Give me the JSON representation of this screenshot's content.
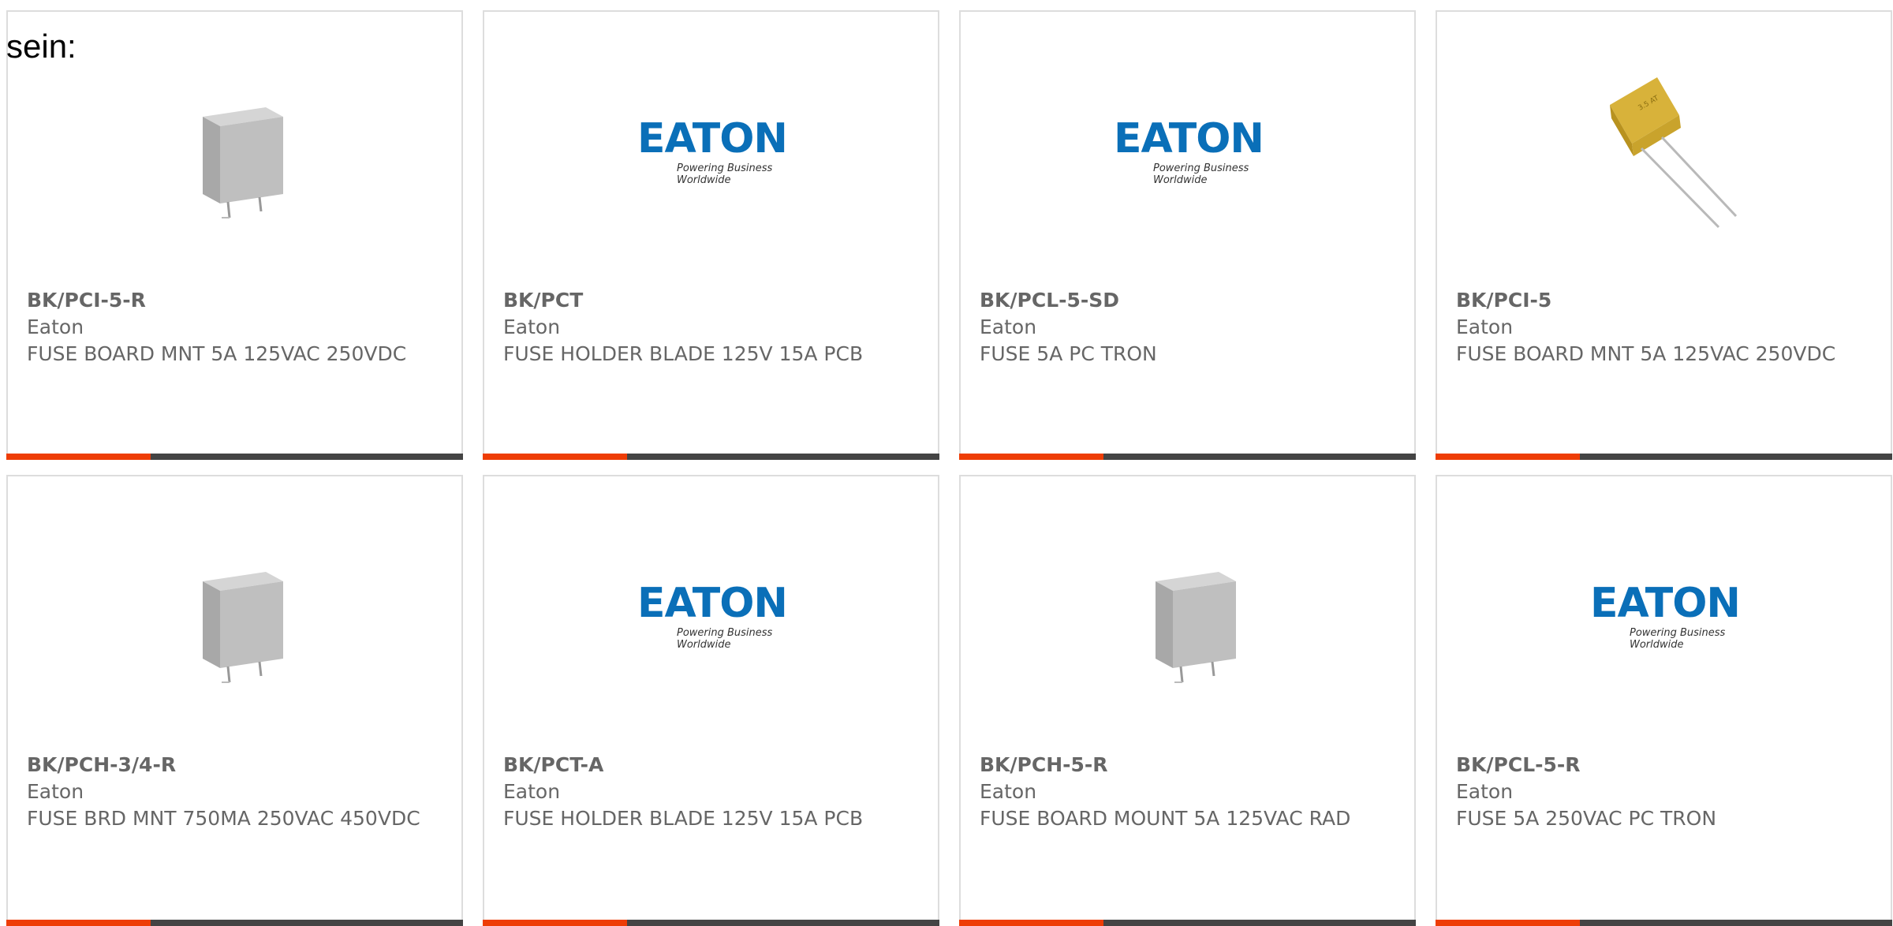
{
  "intro_text": "sein:",
  "colors": {
    "accent": "#ee3d06",
    "bar": "#444444",
    "text": "#666666",
    "eaton_blue": "#0a6fb8",
    "border": "#dddddd"
  },
  "products": [
    {
      "part_number": "BK/PCI-5-R",
      "manufacturer": "Eaton",
      "description": "FUSE BOARD MNT 5A 125VAC 250VDC",
      "image": "grey-component"
    },
    {
      "part_number": "BK/PCT",
      "manufacturer": "Eaton",
      "description": "FUSE HOLDER BLADE 125V 15A PCB",
      "image": "eaton-logo"
    },
    {
      "part_number": "BK/PCL-5-SD",
      "manufacturer": "Eaton",
      "description": "FUSE 5A PC TRON",
      "image": "eaton-logo"
    },
    {
      "part_number": "BK/PCI-5",
      "manufacturer": "Eaton",
      "description": "FUSE BOARD MNT 5A 125VAC 250VDC",
      "image": "yellow-fuse"
    },
    {
      "part_number": "BK/PCH-3/4-R",
      "manufacturer": "Eaton",
      "description": "FUSE BRD MNT 750MA 250VAC 450VDC",
      "image": "grey-component"
    },
    {
      "part_number": "BK/PCT-A",
      "manufacturer": "Eaton",
      "description": "FUSE HOLDER BLADE 125V 15A PCB",
      "image": "eaton-logo"
    },
    {
      "part_number": "BK/PCH-5-R",
      "manufacturer": "Eaton",
      "description": "FUSE BOARD MOUNT 5A 125VAC RAD",
      "image": "grey-component"
    },
    {
      "part_number": "BK/PCL-5-R",
      "manufacturer": "Eaton",
      "description": "FUSE 5A 250VAC PC TRON",
      "image": "eaton-logo"
    }
  ],
  "logo": {
    "wordmark": "EATON",
    "tagline": "Powering Business Worldwide"
  }
}
